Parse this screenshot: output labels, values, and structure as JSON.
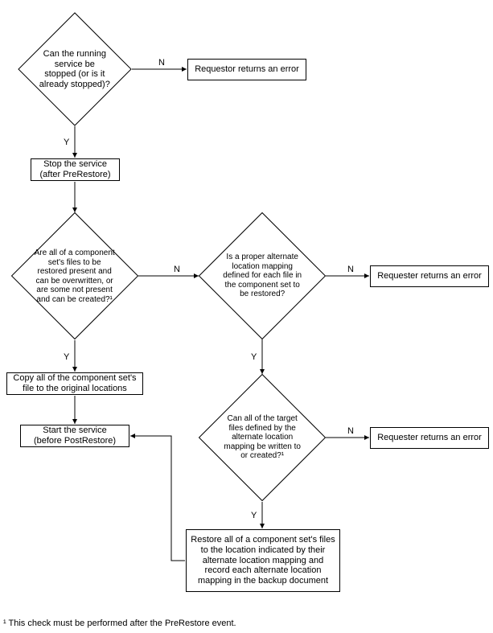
{
  "chart_data": {
    "type": "flowchart",
    "nodes": [
      {
        "id": "d1",
        "shape": "decision",
        "text": "Can the running service be stopped (or is it already stopped)?"
      },
      {
        "id": "p1",
        "shape": "process",
        "text": "Requestor returns an error"
      },
      {
        "id": "p2",
        "shape": "process",
        "text": "Stop the service\n(after PreRestore)"
      },
      {
        "id": "d2",
        "shape": "decision",
        "text": "Are all of a component set's files to be restored present and can be overwritten, or are some not present and can be created?¹"
      },
      {
        "id": "d3",
        "shape": "decision",
        "text": "Is a proper alternate location mapping defined for each file in the component set to be restored?"
      },
      {
        "id": "p3",
        "shape": "process",
        "text": "Requester returns an error"
      },
      {
        "id": "p4",
        "shape": "process",
        "text": "Copy all of the component set's file to the original locations"
      },
      {
        "id": "d4",
        "shape": "decision",
        "text": "Can all of the target files defined by the alternate location mapping be written to or created?¹"
      },
      {
        "id": "p5",
        "shape": "process",
        "text": "Requester returns an error"
      },
      {
        "id": "p6",
        "shape": "process",
        "text": "Start the service\n(before PostRestore)"
      },
      {
        "id": "p7",
        "shape": "process",
        "text": "Restore all of a component set's files to the location indicated by their alternate location mapping and record each alternate location mapping in the backup document"
      }
    ],
    "edges": [
      {
        "from": "d1",
        "to": "p1",
        "label": "N"
      },
      {
        "from": "d1",
        "to": "p2",
        "label": "Y"
      },
      {
        "from": "p2",
        "to": "d2",
        "label": ""
      },
      {
        "from": "d2",
        "to": "d3",
        "label": "N"
      },
      {
        "from": "d2",
        "to": "p4",
        "label": "Y"
      },
      {
        "from": "d3",
        "to": "p3",
        "label": "N"
      },
      {
        "from": "d3",
        "to": "d4",
        "label": "Y"
      },
      {
        "from": "p4",
        "to": "p6",
        "label": ""
      },
      {
        "from": "d4",
        "to": "p5",
        "label": "N"
      },
      {
        "from": "d4",
        "to": "p7",
        "label": "Y"
      },
      {
        "from": "p7",
        "to": "p6",
        "label": ""
      }
    ],
    "footnote": "¹ This check must be performed after the PreRestore event."
  },
  "labels": {
    "Y": "Y",
    "N": "N"
  }
}
